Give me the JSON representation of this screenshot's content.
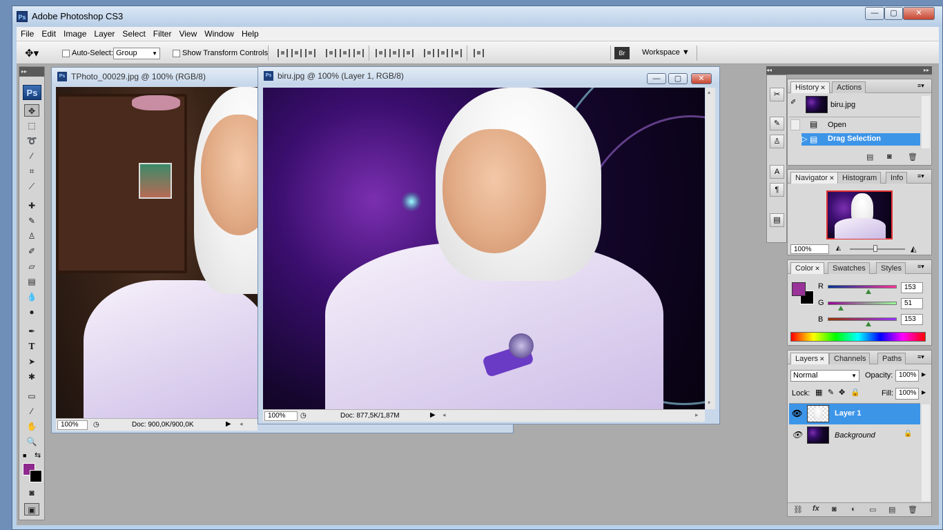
{
  "window": {
    "title": "Adobe Photoshop CS3",
    "app_icon": "Ps",
    "minimize": "—",
    "maximize": "▢",
    "close": "✕"
  },
  "menubar": [
    "File",
    "Edit",
    "Image",
    "Layer",
    "Select",
    "Filter",
    "View",
    "Window",
    "Help"
  ],
  "options": {
    "auto_select_label": "Auto-Select:",
    "auto_select_value": "Group",
    "show_transform_label": "Show Transform Controls",
    "workspace_label": "Workspace"
  },
  "toolbox": {
    "logo": "Ps",
    "fg_color": "#8e2a8e",
    "bg_color": "#000000"
  },
  "doc1": {
    "title": "TPhoto_00029.jpg @ 100% (RGB/8)",
    "zoom": "100%",
    "doc_info": "Doc: 900,0K/900,0K"
  },
  "doc2": {
    "title": "biru.jpg @ 100% (Layer 1, RGB/8)",
    "zoom": "100%",
    "doc_info": "Doc: 877,5K/1,87M"
  },
  "history": {
    "tabs": [
      "History",
      "Actions"
    ],
    "snapshot": "biru.jpg",
    "items": [
      "Open",
      "Drag Selection"
    ]
  },
  "navigator": {
    "tabs": [
      "Navigator",
      "Histogram",
      "Info"
    ],
    "zoom": "100%"
  },
  "color": {
    "tabs": [
      "Color",
      "Swatches",
      "Styles"
    ],
    "r_label": "R",
    "r": "153",
    "g_label": "G",
    "g": "51",
    "b_label": "B",
    "b": "153",
    "swatch": "#993399"
  },
  "layers": {
    "tabs": [
      "Layers",
      "Channels",
      "Paths"
    ],
    "blend": "Normal",
    "opacity_label": "Opacity:",
    "opacity": "100%",
    "lock_label": "Lock:",
    "fill_label": "Fill:",
    "fill": "100%",
    "items": [
      {
        "name": "Layer 1",
        "selected": true
      },
      {
        "name": "Background",
        "selected": false
      }
    ]
  }
}
